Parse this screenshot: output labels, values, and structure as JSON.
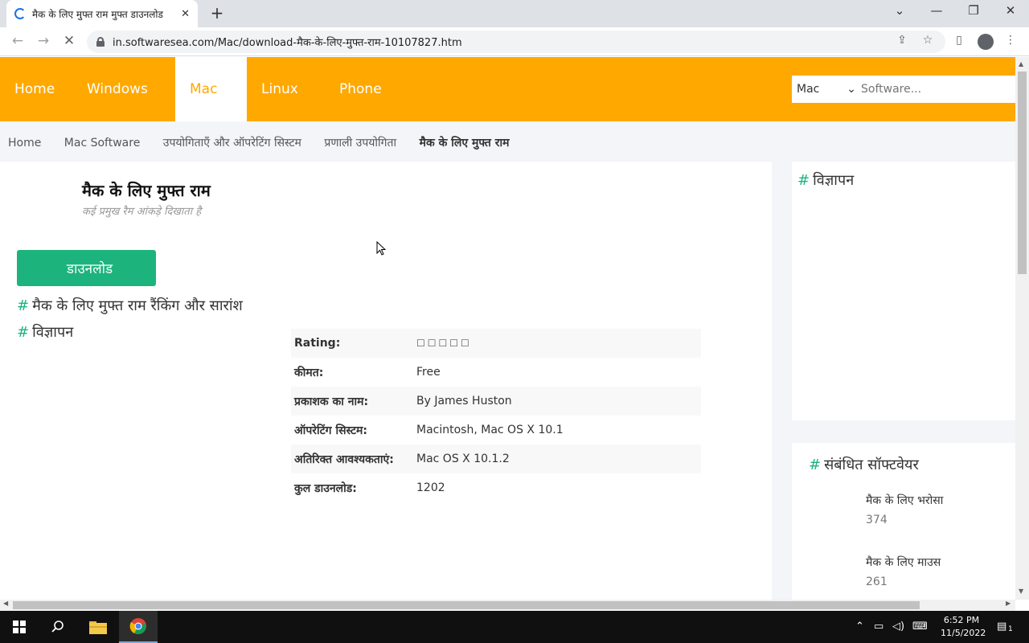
{
  "browser": {
    "tab_title": "मैक के लिए मुफ्त राम मुफ्त डाउनलोड",
    "tab_close": "✕",
    "new_tab": "+",
    "url": "in.softwaresea.com/Mac/download-मैक-के-लिए-मुफ्त-राम-10107827.htm",
    "icons": [
      "back-icon",
      "forward-icon",
      "stop-icon",
      "lock-icon",
      "share-icon",
      "star-icon",
      "sidepanel-icon",
      "profile-icon",
      "menu-icon"
    ]
  },
  "nav": {
    "items": [
      {
        "label": "Home",
        "caret": ""
      },
      {
        "label": "Windows",
        "caret": ""
      },
      {
        "label": "Mac",
        "caret": ""
      },
      {
        "label": "Linux",
        "caret": ""
      },
      {
        "label": "Phone",
        "caret": ""
      }
    ],
    "active": "Mac",
    "search": {
      "select_value": "Mac",
      "select_arrow": "⌄",
      "placeholder": "Software...",
      "icon": ""
    }
  },
  "breadcrumb": {
    "items": [
      "Home",
      "Mac Software",
      "उपयोगिताएँ और ऑपरेटिंग सिस्टम",
      "प्रणाली उपयोगिता",
      "मैक के लिए मुफ्त राम"
    ],
    "separator": ""
  },
  "app": {
    "title": "मैक के लिए मुफ्त राम",
    "subtitle": "कई प्रमुख रैम आंकड़े दिखाता है",
    "download_icon": "",
    "download_label": "डाउनलोड"
  },
  "sections": {
    "hash": "#",
    "ranking": "मैक के लिए मुफ्त राम रैंकिंग और सारांश",
    "ads": "विज्ञापन"
  },
  "info": [
    {
      "key": "Rating:",
      "value": "",
      "rating": 0
    },
    {
      "key": "कीमत:",
      "value": "Free"
    },
    {
      "key": "प्रकाशक का नाम:",
      "value": "By James Huston"
    },
    {
      "key": "ऑपरेटिंग सिस्टम:",
      "value": "Macintosh, Mac OS X 10.1"
    },
    {
      "key": "अतिरिक्त आवश्यकताएं:",
      "value": "Mac OS X 10.1.2"
    },
    {
      "key": "कुल डाउनलोड:",
      "value": "1202"
    }
  ],
  "sidebar": {
    "ads_title": "विज्ञापन",
    "related_title": "संबंधित सॉफ्टवेयर",
    "related": [
      {
        "name": "मैक के लिए भरोसा",
        "icon": "",
        "count": "374"
      },
      {
        "name": "मैक के लिए माउस",
        "icon": "",
        "count": "261"
      }
    ]
  },
  "taskbar": {
    "time": "6:52 PM",
    "date": "11/5/2022",
    "notification_count": "1"
  },
  "colors": {
    "brand": "#ffa800",
    "accent": "#1cb47c",
    "crumb_bg": "#f3f5f9"
  }
}
